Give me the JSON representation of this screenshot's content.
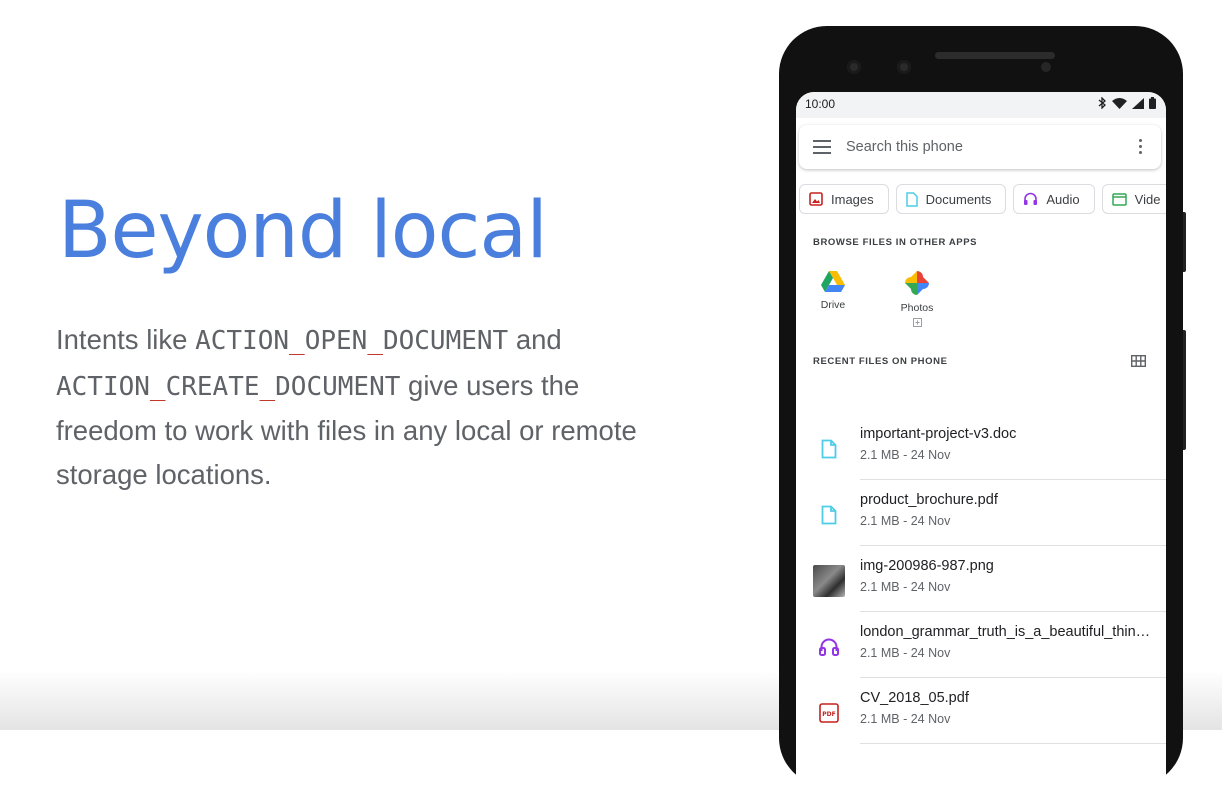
{
  "slide": {
    "title": "Beyond local",
    "body_prefix": "Intents like ",
    "intent_open": [
      "ACTION",
      "OPEN",
      "DOCUMENT"
    ],
    "body_and": " and",
    "intent_create": [
      "ACTION",
      "CREATE",
      "DOCUMENT"
    ],
    "body_suffix_1": " give users the",
    "body_line_3": "freedom to work with files in any local or remote",
    "body_line_4": "storage locations.",
    "underscore": "_"
  },
  "phone": {
    "status": {
      "time": "10:00"
    },
    "search": {
      "placeholder": "Search this phone"
    },
    "chips": [
      {
        "label": "Images",
        "icon": "image-icon",
        "color": "#c5221f"
      },
      {
        "label": "Documents",
        "icon": "document-icon",
        "color": "#4ecde6"
      },
      {
        "label": "Audio",
        "icon": "headphones-icon",
        "color": "#9334e6"
      },
      {
        "label": "Vide",
        "icon": "video-icon",
        "color": "#34a853"
      }
    ],
    "browse_label": "BROWSE FILES IN OTHER APPS",
    "apps": [
      {
        "label": "Drive",
        "icon": "drive-icon"
      },
      {
        "label": "Photos",
        "icon": "photos-icon"
      }
    ],
    "recent_label": "RECENT FILES ON PHONE",
    "files": [
      {
        "name": "important-project-v3.doc",
        "meta": "2.1 MB - 24 Nov",
        "icon": "document-icon"
      },
      {
        "name": "product_brochure.pdf",
        "meta": "2.1 MB - 24 Nov",
        "icon": "document-icon"
      },
      {
        "name": "img-200986-987.png",
        "meta": "2.1 MB - 24 Nov",
        "icon": "image-thumbnail"
      },
      {
        "name": "london_grammar_truth_is_a_beautiful_thin…",
        "meta": "2.1 MB - 24 Nov",
        "icon": "headphones-icon"
      },
      {
        "name": "CV_2018_05.pdf",
        "meta": "2.1 MB - 24 Nov",
        "icon": "pdf-icon"
      }
    ]
  },
  "colors": {
    "title_blue": "#4a7fde",
    "underscore_red": "#c0392b",
    "body_gray": "#5f6368"
  }
}
